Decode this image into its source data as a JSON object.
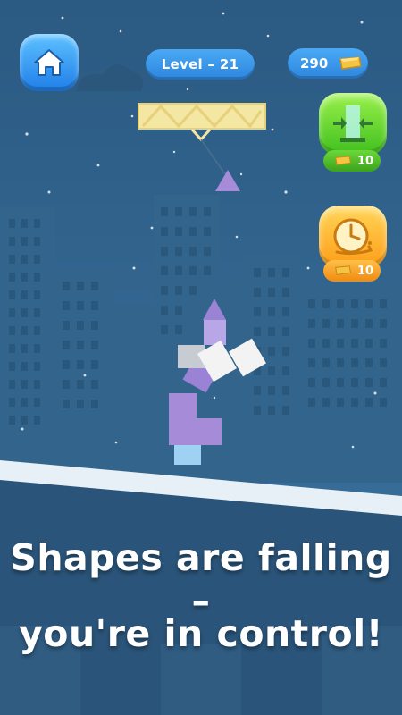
{
  "header": {
    "level_label": "Level – 21",
    "coins": "290"
  },
  "powerups": [
    {
      "name": "widen-base",
      "price": "10",
      "color": "#5fd62e"
    },
    {
      "name": "slow-time",
      "price": "10",
      "color": "#ffb028"
    }
  ],
  "banner": {
    "line1": "Shapes are falling –",
    "line2": "you're in control!"
  },
  "colors": {
    "sky": "#2e5f89",
    "buildings": "#33648c",
    "ground": "#e7f0f7",
    "banner_bg": "#2a5479",
    "block_purple": "#a58bd8",
    "block_gray": "#c7cbd2",
    "block_white": "#f1f1f1",
    "block_blue": "#9fd1f3",
    "crane": "#f4e6a3"
  }
}
